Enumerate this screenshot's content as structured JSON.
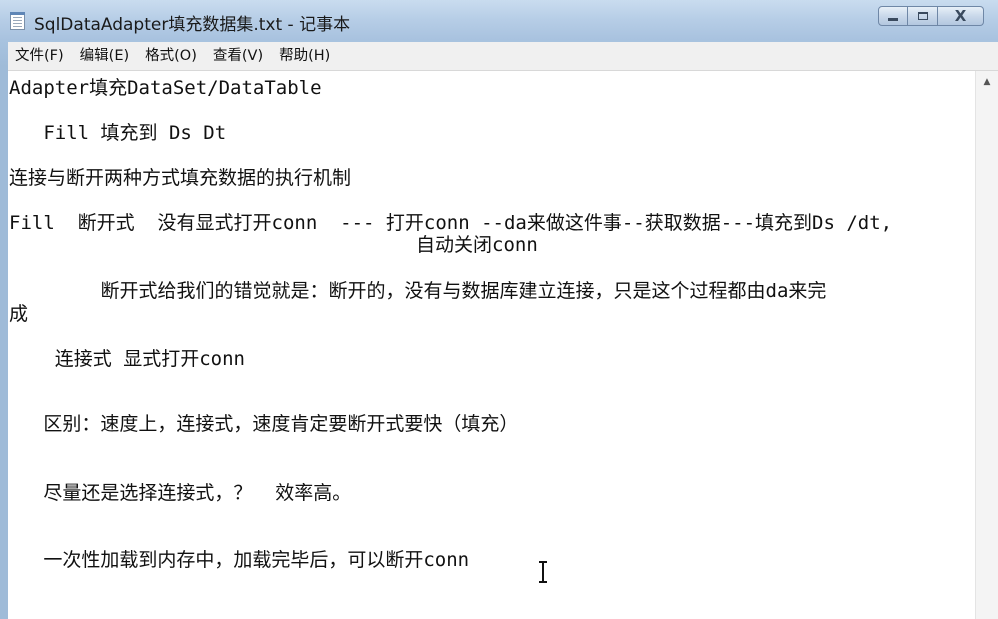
{
  "window": {
    "title": "SqlDataAdapter填充数据集.txt - 记事本",
    "minimize_label": "",
    "maximize_label": "",
    "close_label": "X"
  },
  "menu": {
    "items": [
      {
        "label": "文件(F)"
      },
      {
        "label": "编辑(E)"
      },
      {
        "label": "格式(O)"
      },
      {
        "label": "查看(V)"
      },
      {
        "label": "帮助(H)"
      }
    ]
  },
  "document": {
    "lines": [
      "Adapter填充DataSet/DataTable",
      "   Fill 填充到 Ds Dt",
      "连接与断开两种方式填充数据的执行机制",
      "Fill  断开式  没有显式打开conn  --- 打开conn --da来做这件事--获取数据---填充到Ds /dt,",
      "自动关闭conn",
      "        断开式给我们的错觉就是：断开的，没有与数据库建立连接，只是这个过程都由da来完",
      "成",
      "    连接式 显式打开conn",
      "   区别：速度上，连接式，速度肯定要断开式要快（填充）",
      "   尽量还是选择连接式，？  效率高。",
      "   一次性加载到内存中，加载完毕后，可以断开conn"
    ]
  },
  "icons": {
    "app_icon": "notepad-icon",
    "scroll_up": "scroll-up-arrow-icon",
    "text_cursor": "ibeam-cursor-icon"
  }
}
